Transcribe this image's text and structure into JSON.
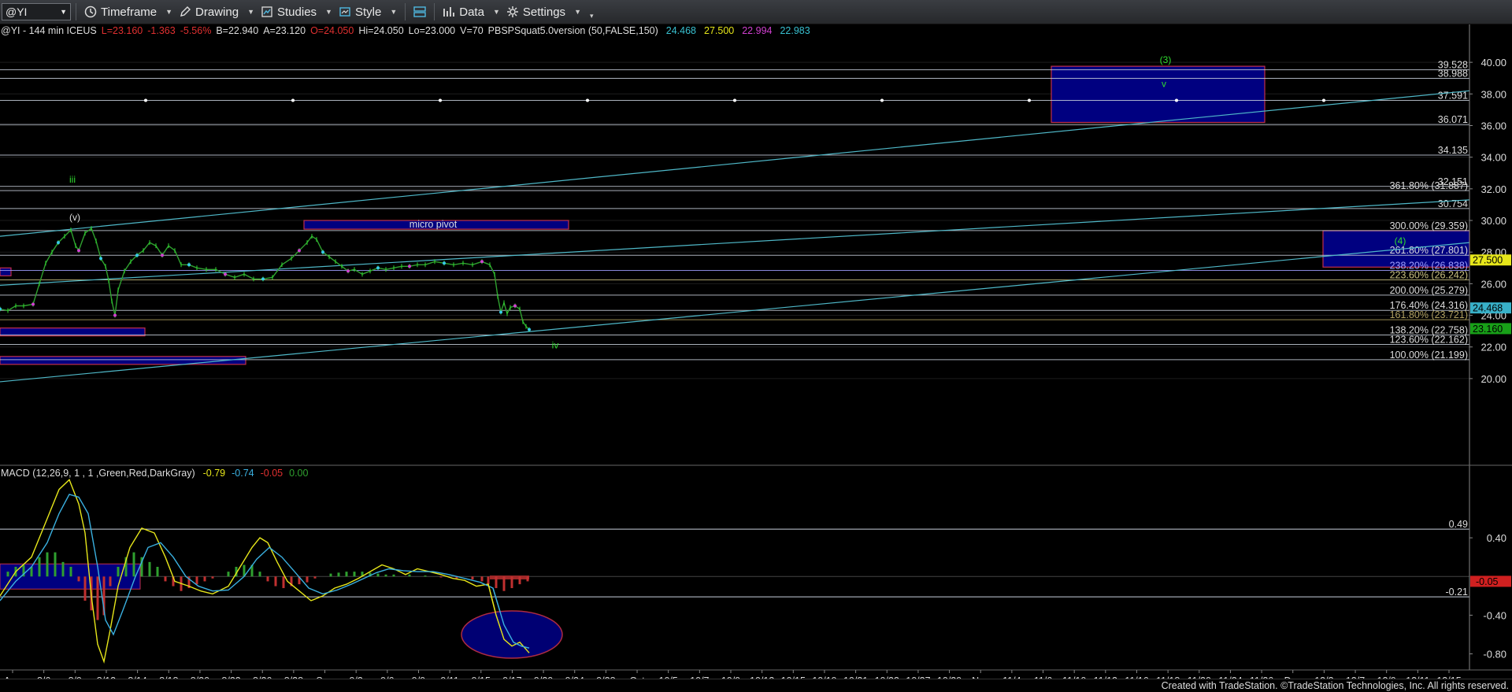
{
  "toolbar": {
    "symbol": "@YI",
    "timeframe_label": "Timeframe",
    "drawing_label": "Drawing",
    "studies_label": "Studies",
    "style_label": "Style",
    "data_label": "Data",
    "settings_label": "Settings"
  },
  "header": {
    "symbol_info": "@YI - 144 min  ICEUS",
    "last": "L=23.160",
    "change": "-1.363",
    "pct": "-5.56%",
    "bid": "B=22.940",
    "ask": "A=23.120",
    "open": "O=24.050",
    "high": "Hi=24.050",
    "low": "Lo=23.000",
    "volume": "V=70",
    "study": "PBSPSquat5.0version (50,FALSE,150)",
    "study_values": [
      "24.468",
      "27.500",
      "22.994",
      "22.983"
    ]
  },
  "colors": {
    "bg": "#000000",
    "grid": "#1c1c1c",
    "hline": "#c8d0dc",
    "trend": "#4fb8c8",
    "price_up": "#2fdd2f",
    "price_down": "#2fa02f",
    "box_fill": "#000080",
    "box_border": "#c0304a",
    "macd": "#e6e61a",
    "signal": "#3ab0e0",
    "hist_pos": "#2fa02f",
    "hist_neg": "#c03030"
  },
  "chart_data": [
    {
      "type": "line",
      "panel": "price",
      "ylim": [
        19,
        41.5
      ],
      "y_ticks": [
        "40.00",
        "38.00",
        "36.00",
        "34.00",
        "32.00",
        "30.00",
        "28.00",
        "26.00",
        "24.00",
        "22.00",
        "20.00"
      ],
      "y_tick_values": [
        40,
        38,
        36,
        34,
        32,
        30,
        28,
        26,
        24,
        22,
        20
      ],
      "x_labels": [
        "Aug",
        "8/6",
        "8/9",
        "8/12",
        "8/14",
        "8/18",
        "8/20",
        "8/23",
        "8/26",
        "8/28",
        "Sep",
        "9/3",
        "9/6",
        "9/9",
        "9/11",
        "9/15",
        "9/17",
        "9/20",
        "9/24",
        "9/28",
        "Oct",
        "10/5",
        "10/7",
        "10/9",
        "10/13",
        "10/15",
        "10/19",
        "10/21",
        "10/23",
        "10/27",
        "10/29",
        "Nov",
        "11/4",
        "11/6",
        "11/10",
        "11/12",
        "11/16",
        "11/18",
        "11/20",
        "11/24",
        "11/26",
        "Dec",
        "12/3",
        "12/7",
        "12/9",
        "12/11",
        "12/15"
      ],
      "price_path": [
        [
          0,
          24.4
        ],
        [
          10,
          24.3
        ],
        [
          20,
          24.6
        ],
        [
          30,
          24.6
        ],
        [
          42,
          24.7
        ],
        [
          50,
          26.0
        ],
        [
          58,
          27.3
        ],
        [
          66,
          28.0
        ],
        [
          74,
          28.6
        ],
        [
          82,
          29.0
        ],
        [
          90,
          29.4
        ],
        [
          96,
          28.4
        ],
        [
          100,
          28.1
        ],
        [
          108,
          29.2
        ],
        [
          116,
          29.5
        ],
        [
          122,
          28.7
        ],
        [
          128,
          27.6
        ],
        [
          134,
          27.1
        ],
        [
          138,
          26.2
        ],
        [
          142,
          24.9
        ],
        [
          146,
          24.0
        ],
        [
          150,
          25.6
        ],
        [
          158,
          26.8
        ],
        [
          166,
          27.4
        ],
        [
          174,
          27.8
        ],
        [
          182,
          28.1
        ],
        [
          190,
          28.6
        ],
        [
          198,
          28.4
        ],
        [
          206,
          27.8
        ],
        [
          214,
          28.4
        ],
        [
          222,
          28.1
        ],
        [
          230,
          27.2
        ],
        [
          240,
          27.2
        ],
        [
          250,
          27.0
        ],
        [
          262,
          26.9
        ],
        [
          274,
          26.9
        ],
        [
          286,
          26.6
        ],
        [
          298,
          26.4
        ],
        [
          310,
          26.6
        ],
        [
          322,
          26.3
        ],
        [
          334,
          26.3
        ],
        [
          346,
          26.4
        ],
        [
          358,
          27.2
        ],
        [
          370,
          27.6
        ],
        [
          380,
          28.1
        ],
        [
          390,
          28.6
        ],
        [
          396,
          29.0
        ],
        [
          402,
          28.8
        ],
        [
          410,
          28.0
        ],
        [
          418,
          27.7
        ],
        [
          426,
          27.4
        ],
        [
          434,
          27.1
        ],
        [
          442,
          26.8
        ],
        [
          450,
          26.9
        ],
        [
          460,
          26.6
        ],
        [
          470,
          26.8
        ],
        [
          480,
          27.0
        ],
        [
          490,
          26.9
        ],
        [
          500,
          27.0
        ],
        [
          510,
          27.1
        ],
        [
          520,
          27.1
        ],
        [
          530,
          27.2
        ],
        [
          540,
          27.2
        ],
        [
          552,
          27.4
        ],
        [
          564,
          27.3
        ],
        [
          576,
          27.2
        ],
        [
          588,
          27.3
        ],
        [
          600,
          27.2
        ],
        [
          612,
          27.4
        ],
        [
          622,
          27.2
        ],
        [
          628,
          26.6
        ],
        [
          632,
          25.2
        ],
        [
          636,
          24.2
        ],
        [
          640,
          24.8
        ],
        [
          644,
          24.1
        ],
        [
          648,
          24.5
        ],
        [
          654,
          24.6
        ],
        [
          660,
          24.4
        ],
        [
          664,
          23.6
        ],
        [
          668,
          23.3
        ],
        [
          672,
          23.1
        ]
      ],
      "series": [
        {
          "name": "PBSPSquat5.0version",
          "values": [
            24.468,
            27.5,
            22.994,
            22.983
          ]
        }
      ],
      "hlines": [
        {
          "label": "39.528",
          "y": 39.528
        },
        {
          "label": "38.988",
          "y": 38.988
        },
        {
          "label": "37.591",
          "y": 37.591,
          "dotted": true
        },
        {
          "label": "36.071",
          "y": 36.071
        },
        {
          "label": "34.135",
          "y": 34.135
        },
        {
          "label": "32.151",
          "y": 32.151
        },
        {
          "label": "361.80% (31.887)",
          "y": 31.887
        },
        {
          "label": "30.754",
          "y": 30.754
        },
        {
          "label": "300.00% (29.359)",
          "y": 29.359
        },
        {
          "label": "261.80% (27.801)",
          "y": 27.801
        },
        {
          "label": "238.20% (26.838)",
          "y": 26.838
        },
        {
          "label": "223.60% (26.242)",
          "y": 26.242
        },
        {
          "label": "200.00% (25.279)",
          "y": 25.279
        },
        {
          "label": "176.40% (24.316)",
          "y": 24.316
        },
        {
          "label": "161.80% (23.721)",
          "y": 23.721
        },
        {
          "label": "138.20% (22.758)",
          "y": 22.758
        },
        {
          "label": "123.60% (22.162)",
          "y": 22.162
        },
        {
          "label": "100.00% (21.199)",
          "y": 21.199
        }
      ],
      "price_tags": [
        {
          "label": "27.500",
          "y": 27.5,
          "color": "#e6e61a"
        },
        {
          "label": "24.468",
          "y": 24.468,
          "color": "#38b0c8"
        },
        {
          "label": "23.160",
          "y": 23.16,
          "color": "#18a018"
        }
      ],
      "annotations": [
        {
          "text": "(3)",
          "color": "#2fdd2f"
        },
        {
          "text": "v",
          "color": "#2fdd2f"
        },
        {
          "text": "(4)",
          "color": "#2fdd2f"
        },
        {
          "text": "iii",
          "color": "#2fdd2f"
        },
        {
          "text": "(v)",
          "color": "#dddddd"
        },
        {
          "text": "iv",
          "color": "#2fdd2f"
        },
        {
          "text": "micro pivot",
          "color": "#dddddd"
        }
      ]
    },
    {
      "type": "line",
      "panel": "macd",
      "title": "MACD (12,26,9, 1 , 1 ,Green,Red,DarkGray)",
      "legend_values": [
        {
          "value": "-0.79",
          "color": "#e6e61a"
        },
        {
          "value": "-0.74",
          "color": "#3ab0e0"
        },
        {
          "value": "-0.05",
          "color": "#e03030"
        },
        {
          "value": "0.00",
          "color": "#2fa02f"
        }
      ],
      "ylim": [
        -0.95,
        1.15
      ],
      "y_ticks": [
        "0.40",
        "-0.40",
        "-0.80"
      ],
      "y_tick_values": [
        0.4,
        -0.4,
        -0.8
      ],
      "hlines": [
        {
          "label": "0.49",
          "y": 0.49
        },
        {
          "label": "-0.21",
          "y": -0.21
        }
      ],
      "price_tags": [
        {
          "label": "-0.05",
          "y": -0.05,
          "color": "#d02020"
        }
      ],
      "macd_path": [
        [
          0,
          -0.2
        ],
        [
          20,
          0.05
        ],
        [
          40,
          0.2
        ],
        [
          60,
          0.6
        ],
        [
          75,
          0.9
        ],
        [
          88,
          1.0
        ],
        [
          100,
          0.75
        ],
        [
          108,
          0.45
        ],
        [
          116,
          -0.2
        ],
        [
          124,
          -0.7
        ],
        [
          132,
          -0.88
        ],
        [
          140,
          -0.55
        ],
        [
          150,
          -0.1
        ],
        [
          165,
          0.3
        ],
        [
          180,
          0.5
        ],
        [
          196,
          0.45
        ],
        [
          210,
          0.2
        ],
        [
          222,
          -0.05
        ],
        [
          240,
          -0.1
        ],
        [
          255,
          -0.15
        ],
        [
          270,
          -0.18
        ],
        [
          290,
          -0.1
        ],
        [
          305,
          0.1
        ],
        [
          320,
          0.3
        ],
        [
          330,
          0.4
        ],
        [
          340,
          0.35
        ],
        [
          352,
          0.15
        ],
        [
          365,
          -0.05
        ],
        [
          380,
          -0.15
        ],
        [
          395,
          -0.25
        ],
        [
          410,
          -0.2
        ],
        [
          425,
          -0.12
        ],
        [
          440,
          -0.08
        ],
        [
          455,
          -0.02
        ],
        [
          470,
          0.05
        ],
        [
          485,
          0.12
        ],
        [
          500,
          0.08
        ],
        [
          515,
          0.02
        ],
        [
          530,
          0.08
        ],
        [
          545,
          0.05
        ],
        [
          560,
          0.02
        ],
        [
          575,
          -0.02
        ],
        [
          590,
          -0.04
        ],
        [
          605,
          -0.1
        ],
        [
          620,
          -0.08
        ],
        [
          630,
          -0.4
        ],
        [
          640,
          -0.65
        ],
        [
          650,
          -0.72
        ],
        [
          660,
          -0.68
        ],
        [
          672,
          -0.79
        ]
      ],
      "signal_path": [
        [
          0,
          -0.25
        ],
        [
          20,
          -0.05
        ],
        [
          40,
          0.1
        ],
        [
          60,
          0.35
        ],
        [
          75,
          0.65
        ],
        [
          88,
          0.85
        ],
        [
          100,
          0.82
        ],
        [
          112,
          0.65
        ],
        [
          124,
          0.1
        ],
        [
          134,
          -0.45
        ],
        [
          144,
          -0.6
        ],
        [
          156,
          -0.35
        ],
        [
          172,
          0.0
        ],
        [
          188,
          0.3
        ],
        [
          204,
          0.35
        ],
        [
          220,
          0.2
        ],
        [
          236,
          0.0
        ],
        [
          252,
          -0.1
        ],
        [
          270,
          -0.15
        ],
        [
          290,
          -0.14
        ],
        [
          310,
          0.0
        ],
        [
          326,
          0.18
        ],
        [
          342,
          0.3
        ],
        [
          358,
          0.2
        ],
        [
          374,
          0.05
        ],
        [
          392,
          -0.12
        ],
        [
          410,
          -0.18
        ],
        [
          428,
          -0.14
        ],
        [
          446,
          -0.08
        ],
        [
          462,
          -0.02
        ],
        [
          478,
          0.04
        ],
        [
          494,
          0.08
        ],
        [
          512,
          0.06
        ],
        [
          530,
          0.05
        ],
        [
          550,
          0.05
        ],
        [
          570,
          0.02
        ],
        [
          590,
          -0.02
        ],
        [
          610,
          -0.06
        ],
        [
          626,
          -0.12
        ],
        [
          640,
          -0.5
        ],
        [
          652,
          -0.68
        ],
        [
          662,
          -0.72
        ],
        [
          672,
          -0.74
        ]
      ],
      "hist": [
        [
          10,
          0.05
        ],
        [
          20,
          0.1
        ],
        [
          30,
          0.12
        ],
        [
          40,
          0.1
        ],
        [
          50,
          0.2
        ],
        [
          60,
          0.25
        ],
        [
          70,
          0.25
        ],
        [
          80,
          0.15
        ],
        [
          90,
          0.1
        ],
        [
          100,
          -0.05
        ],
        [
          108,
          -0.25
        ],
        [
          116,
          -0.35
        ],
        [
          124,
          -0.45
        ],
        [
          132,
          -0.4
        ],
        [
          140,
          -0.1
        ],
        [
          150,
          0.1
        ],
        [
          160,
          0.2
        ],
        [
          170,
          0.25
        ],
        [
          180,
          0.2
        ],
        [
          190,
          0.15
        ],
        [
          200,
          0.1
        ],
        [
          210,
          -0.05
        ],
        [
          220,
          -0.1
        ],
        [
          230,
          -0.15
        ],
        [
          240,
          -0.12
        ],
        [
          250,
          -0.08
        ],
        [
          260,
          -0.05
        ],
        [
          270,
          -0.02
        ],
        [
          290,
          0.05
        ],
        [
          300,
          0.1
        ],
        [
          310,
          0.12
        ],
        [
          320,
          0.12
        ],
        [
          330,
          0.05
        ],
        [
          340,
          -0.05
        ],
        [
          350,
          -0.1
        ],
        [
          360,
          -0.12
        ],
        [
          370,
          -0.1
        ],
        [
          380,
          -0.08
        ],
        [
          390,
          -0.06
        ],
        [
          400,
          -0.02
        ],
        [
          410,
          0.0
        ],
        [
          420,
          0.03
        ],
        [
          430,
          0.04
        ],
        [
          440,
          0.05
        ],
        [
          450,
          0.05
        ],
        [
          460,
          0.05
        ],
        [
          470,
          0.04
        ],
        [
          480,
          0.03
        ],
        [
          490,
          0.02
        ],
        [
          500,
          0.02
        ],
        [
          520,
          0.02
        ],
        [
          540,
          0.01
        ],
        [
          560,
          -0.01
        ],
        [
          580,
          -0.02
        ],
        [
          600,
          -0.03
        ],
        [
          612,
          -0.05
        ],
        [
          620,
          -0.08
        ],
        [
          630,
          -0.12
        ],
        [
          640,
          -0.15
        ],
        [
          650,
          -0.12
        ],
        [
          660,
          -0.08
        ],
        [
          670,
          -0.05
        ]
      ]
    }
  ],
  "footer_text": "Created with TradeStation. ©TradeStation Technologies, Inc. All rights reserved."
}
